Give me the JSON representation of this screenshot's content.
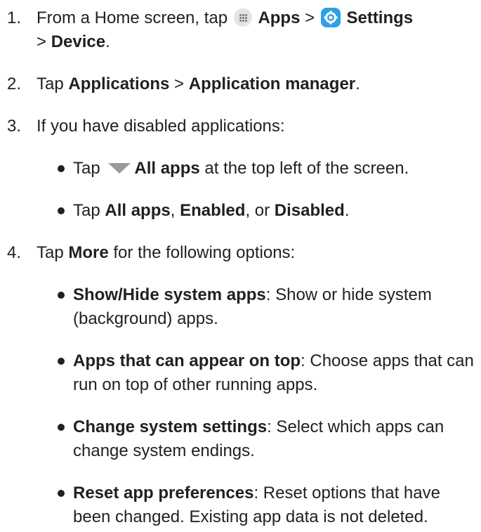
{
  "steps": [
    {
      "num": "1.",
      "t1": "From a Home screen, tap ",
      "icon1": "apps-grid-icon",
      "apps": "Apps",
      "sep1": " > ",
      "icon2": "settings-gear-icon",
      "settings": "Settings",
      "sep2": "> ",
      "device": "Device",
      "end": "."
    },
    {
      "num": "2.",
      "t1": "Tap ",
      "b1": "Applications",
      "sep": " > ",
      "b2": "Application manager",
      "end": "."
    },
    {
      "num": "3.",
      "text": "If you have disabled applications:",
      "bullets": [
        {
          "t1": "Tap ",
          "icon": "dropdown-triangle-icon",
          "b1": "All apps",
          "t2": " at the top left of the screen."
        },
        {
          "t1": "Tap ",
          "b1": "All apps",
          "t2": ", ",
          "b2": "Enabled",
          "t3": ", or ",
          "b3": "Disabled",
          "t4": "."
        }
      ]
    },
    {
      "num": "4.",
      "t1": "Tap ",
      "b1": "More",
      "t2": " for the following options:",
      "bullets": [
        {
          "b": "Show/Hide system apps",
          "t": ": Show or hide system (background) apps."
        },
        {
          "b": "Apps that can appear on top",
          "t": ": Choose apps that can run on top of other running apps."
        },
        {
          "b": "Change system settings",
          "t": ": Select which apps can change system endings."
        },
        {
          "b": "Reset app preferences",
          "t": ": Reset options that have been changed. Existing app data is not deleted."
        }
      ]
    }
  ],
  "colors": {
    "text": "#231f20",
    "settings_icon_bg": "#2f9fe8",
    "apps_icon_bg": "#e4e4e4",
    "triangle": "#9a9a9a"
  }
}
